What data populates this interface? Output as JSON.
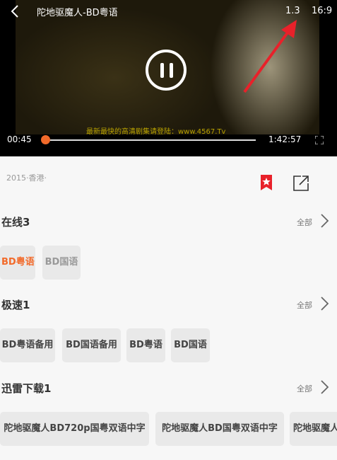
{
  "player": {
    "title": "陀地驱魔人-BD粤语",
    "speed": "1.3",
    "aspect_ratio": "16:9",
    "watermark": "最新最快的高清剧集请登陆：www.4567.Tv",
    "time_current": "00:45",
    "time_total": "1:42:57",
    "progress_fraction": 0.007
  },
  "info": {
    "meta": "2015·香港·"
  },
  "sections": [
    {
      "title": "在线3",
      "more": "全部",
      "sources": [
        "BD粤语",
        "BD国语"
      ]
    },
    {
      "title": "极速1",
      "more": "全部",
      "sources": [
        "BD粤语备用",
        "BD国语备用",
        "BD粤语",
        "BD国语"
      ]
    },
    {
      "title": "迅雷下载1",
      "more": "全部",
      "sources": [
        "陀地驱魔人BD720p国粤双语中字",
        "陀地驱魔人BD国粤双语中字",
        "陀地驱魔人"
      ]
    }
  ],
  "colors": {
    "accent": "#f26a2a",
    "bookmark": "#e8212a",
    "annotation_arrow": "#e8212a"
  }
}
